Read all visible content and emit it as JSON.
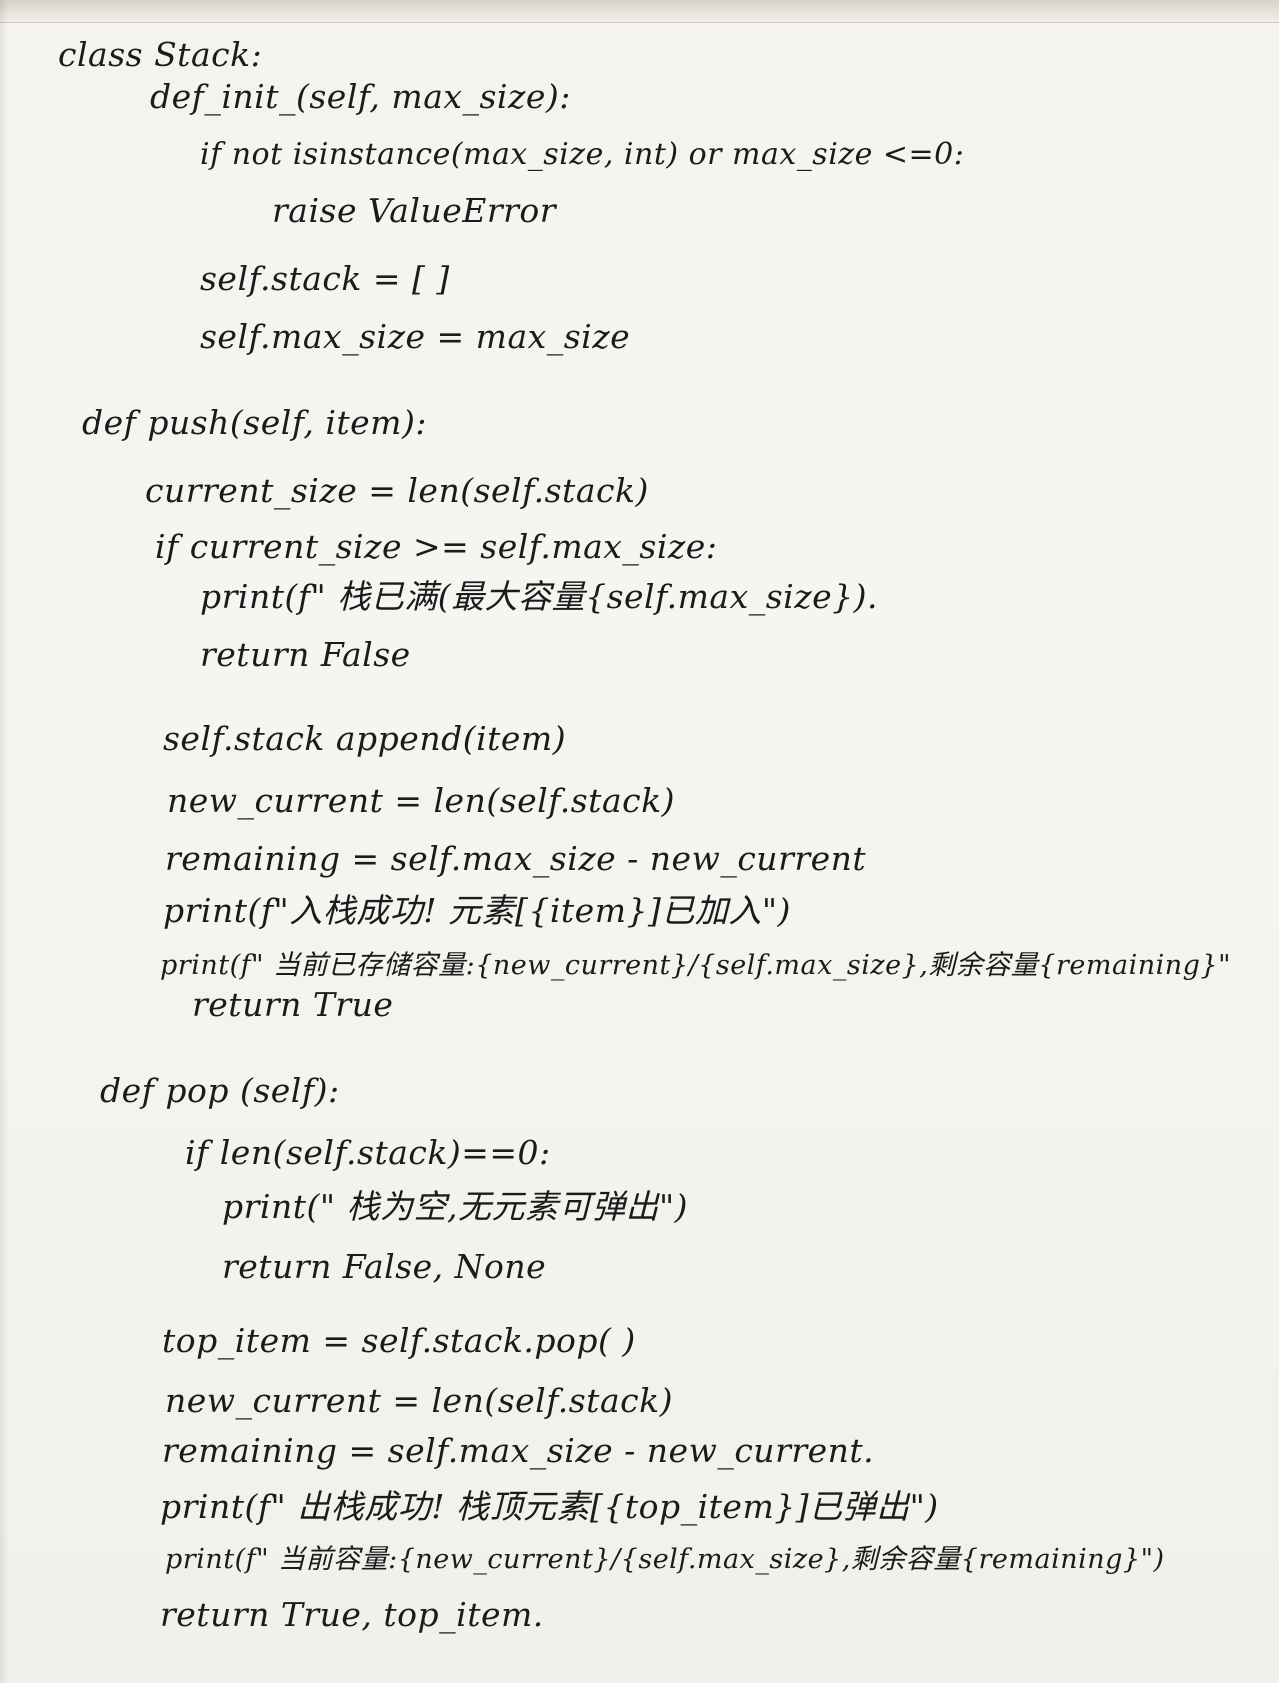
{
  "code_lines": [
    "class  Stack:",
    "def_init_(self, max_size):",
    "if not isinstance(max_size, int) or max_size <=0:",
    "raise  ValueError",
    "self.stack = [ ]",
    "self.max_size = max_size",
    "def  push(self, item):",
    "current_size =  len(self.stack)",
    "if current_size >= self.max_size:",
    "print(f\" 栈已满(最大容量{self.max_size}).",
    "return   False",
    "self.stack  append(item)",
    "new_current   = len(self.stack)",
    "remaining  = self.max_size - new_current",
    "print(f\"入栈成功! 元素[{item}]已加入\")",
    "print(f\" 当前已存储容量:{new_current}/{self.max_size},剩余容量{remaining}\"",
    "return   True",
    "def  pop (self):",
    "if  len(self.stack)==0:",
    "print(\" 栈为空,无元素可弹出\")",
    "return   False, None",
    "top_item = self.stack.pop( )",
    "new_current  =  len(self.stack)",
    "remaining = self.max_size - new_current.",
    "print(f\" 出栈成功! 栈顶元素[{top_item}]已弹出\")",
    "print(f\" 当前容量:{new_current}/{self.max_size},剩余容量{remaining}\")",
    "return   True, top_item."
  ]
}
